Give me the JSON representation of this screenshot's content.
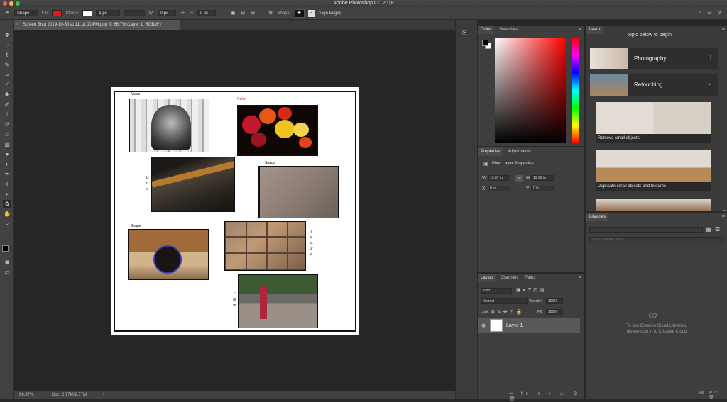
{
  "app": {
    "window_title": "Adobe Photoshop CC 2018"
  },
  "options_bar": {
    "mode": "Shape",
    "fill_label": "Fill:",
    "stroke_label": "Stroke:",
    "stroke_width": "1 px",
    "w_label": "W:",
    "w_value": "0 px",
    "h_label": "H:",
    "h_value": "0 px",
    "shape_label": "Shape:",
    "align_edges": "Align Edges"
  },
  "document": {
    "tab_title": "Screen Shot 2019-10-30 at 11.18.00 PM.png @ 66.7% (Layer 1, RGB/8*)",
    "zoom": "66.67%",
    "doc_info": "Doc: 2.77M/2.77M"
  },
  "artwork": {
    "labels": {
      "value": "Value",
      "color": "Color",
      "line": "Line",
      "space": "Space",
      "shape": "Shape",
      "texture": "Texture",
      "form": "Form"
    }
  },
  "color_panel": {
    "tabs": [
      "Color",
      "Swatches"
    ]
  },
  "properties_panel": {
    "tabs": [
      "Properties",
      "Adjustments"
    ],
    "heading": "Pixel Layer Properties",
    "w_label": "W:",
    "w_value": "13.67 in",
    "h_label": "H:",
    "h_value": "13.68 in",
    "x_label": "X:",
    "x_value": "0 in",
    "y_label": "Y:",
    "y_value": "0 in"
  },
  "layers_panel": {
    "tabs": [
      "Layers",
      "Channels",
      "Paths"
    ],
    "kind": "Kind",
    "blend_mode": "Normal",
    "opacity_label": "Opacity:",
    "opacity_value": "100%",
    "lock_label": "Lock:",
    "fill_label": "Fill:",
    "fill_value": "100%",
    "layer_name": "Layer 1"
  },
  "learn_panel": {
    "tab": "Learn",
    "intro": "topic below to begin.",
    "topics": [
      {
        "label": "Photography"
      },
      {
        "label": "Retouching"
      }
    ],
    "cards": [
      {
        "label": "Remove small objects"
      },
      {
        "label": "Duplicate small objects and textures"
      }
    ]
  },
  "libraries_panel": {
    "tab": "Libraries",
    "search_placeholder": "Search Adobe Stock",
    "message_line1": "To use Creative Cloud Libraries,",
    "message_line2": "please sign in to Creative Cloud",
    "size": "-- KB"
  },
  "colors": {
    "fill": "#e8141c",
    "accent": "#2f7bd6"
  }
}
